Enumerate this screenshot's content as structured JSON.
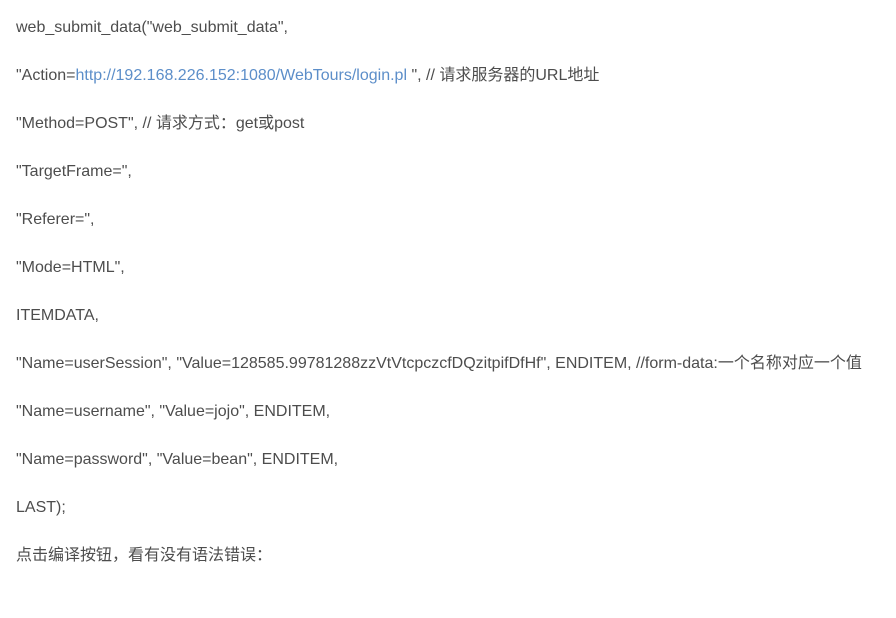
{
  "lines": {
    "l1": "web_submit_data(\"web_submit_data\",",
    "l2_pre": "\"Action=",
    "l2_url": "http://192.168.226.152:1080/WebTours/login.pl ",
    "l2_post": "\", // 请求服务器的URL地址",
    "l3": "\"Method=POST\", // 请求方式：get或post",
    "l4": "\"TargetFrame=\",",
    "l5": "\"Referer=\",",
    "l6": "\"Mode=HTML\",",
    "l7": "ITEMDATA,",
    "l8": "\"Name=userSession\", \"Value=128585.99781288zzVtVtcpczcfDQzitpifDfHf\", ENDITEM, //form-data:一个名称对应一个值",
    "l9": "\"Name=username\", \"Value=jojo\", ENDITEM,",
    "l10": "\"Name=password\", \"Value=bean\", ENDITEM,",
    "l11": "LAST);",
    "l12": "点击编译按钮，看有没有语法错误："
  }
}
